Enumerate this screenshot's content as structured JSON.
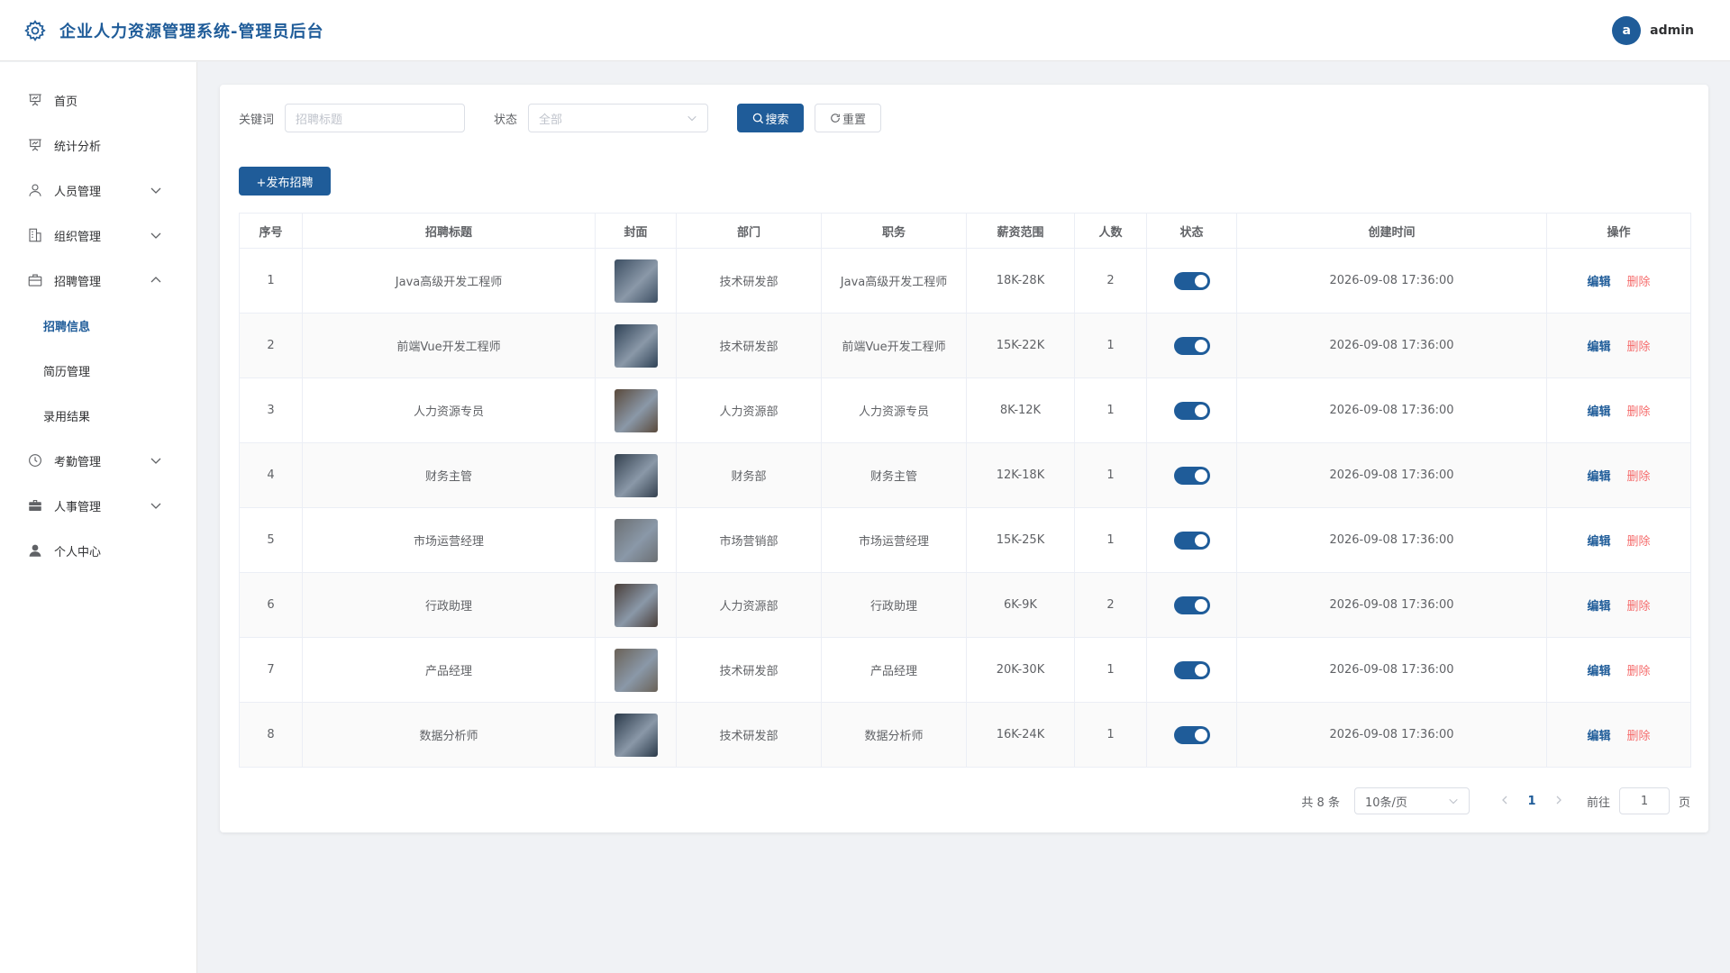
{
  "header": {
    "title": "企业人力资源管理系统-管理员后台",
    "avatar_letter": "a",
    "username": "admin",
    "brand_color": "#1f5c99"
  },
  "sidebar": {
    "items": [
      {
        "label": "首页",
        "icon": "presentation-icon"
      },
      {
        "label": "统计分析",
        "icon": "presentation-icon"
      },
      {
        "label": "人员管理",
        "icon": "user-icon",
        "expandable": true
      },
      {
        "label": "组织管理",
        "icon": "building-icon",
        "expandable": true
      },
      {
        "label": "招聘管理",
        "icon": "briefcase-icon",
        "expandable": true,
        "expanded": true
      },
      {
        "label": "考勤管理",
        "icon": "clock-icon",
        "expandable": true
      },
      {
        "label": "人事管理",
        "icon": "suitcase-icon",
        "expandable": true
      },
      {
        "label": "个人中心",
        "icon": "person-icon"
      }
    ],
    "sub_items": [
      {
        "label": "招聘信息",
        "active": true
      },
      {
        "label": "简历管理"
      },
      {
        "label": "录用结果"
      }
    ]
  },
  "filters": {
    "keyword_label": "关键词",
    "keyword_placeholder": "招聘标题",
    "status_label": "状态",
    "status_value": "全部",
    "search_label": "搜索",
    "reset_label": "重置"
  },
  "publish_label": "+发布招聘",
  "table": {
    "headers": [
      "序号",
      "招聘标题",
      "封面",
      "部门",
      "职务",
      "薪资范围",
      "人数",
      "状态",
      "创建时间",
      "操作"
    ],
    "edit_label": "编辑",
    "delete_label": "删除",
    "rows": [
      {
        "no": "1",
        "title": "Java高级开发工程师",
        "cover_color": "#3d4f63",
        "dept": "技术研发部",
        "position": "Java高级开发工程师",
        "salary": "18K-28K",
        "count": "2",
        "status": "on",
        "created": "2026-09-08 17:36:00"
      },
      {
        "no": "2",
        "title": "前端Vue开发工程师",
        "cover_color": "#2f4256",
        "dept": "技术研发部",
        "position": "前端Vue开发工程师",
        "salary": "15K-22K",
        "count": "1",
        "status": "on",
        "created": "2026-09-08 17:36:00"
      },
      {
        "no": "3",
        "title": "人力资源专员",
        "cover_color": "#5a4a3c",
        "dept": "人力资源部",
        "position": "人力资源专员",
        "salary": "8K-12K",
        "count": "1",
        "status": "on",
        "created": "2026-09-08 17:36:00"
      },
      {
        "no": "4",
        "title": "财务主管",
        "cover_color": "#34414f",
        "dept": "财务部",
        "position": "财务主管",
        "salary": "12K-18K",
        "count": "1",
        "status": "on",
        "created": "2026-09-08 17:36:00"
      },
      {
        "no": "5",
        "title": "市场运营经理",
        "cover_color": "#6b6f73",
        "dept": "市场营销部",
        "position": "市场运营经理",
        "salary": "15K-25K",
        "count": "1",
        "status": "on",
        "created": "2026-09-08 17:36:00"
      },
      {
        "no": "6",
        "title": "行政助理",
        "cover_color": "#4a3f3a",
        "dept": "人力资源部",
        "position": "行政助理",
        "salary": "6K-9K",
        "count": "2",
        "status": "on",
        "created": "2026-09-08 17:36:00"
      },
      {
        "no": "7",
        "title": "产品经理",
        "cover_color": "#6a6258",
        "dept": "技术研发部",
        "position": "产品经理",
        "salary": "20K-30K",
        "count": "1",
        "status": "on",
        "created": "2026-09-08 17:36:00"
      },
      {
        "no": "8",
        "title": "数据分析师",
        "cover_color": "#2b3a4a",
        "dept": "技术研发部",
        "position": "数据分析师",
        "salary": "16K-24K",
        "count": "1",
        "status": "on",
        "created": "2026-09-08 17:36:00"
      }
    ]
  },
  "pagination": {
    "total_text": "共 8 条",
    "page_size": "10条/页",
    "current_page": "1",
    "goto_label": "前往",
    "goto_value": "1",
    "page_suffix": "页"
  }
}
